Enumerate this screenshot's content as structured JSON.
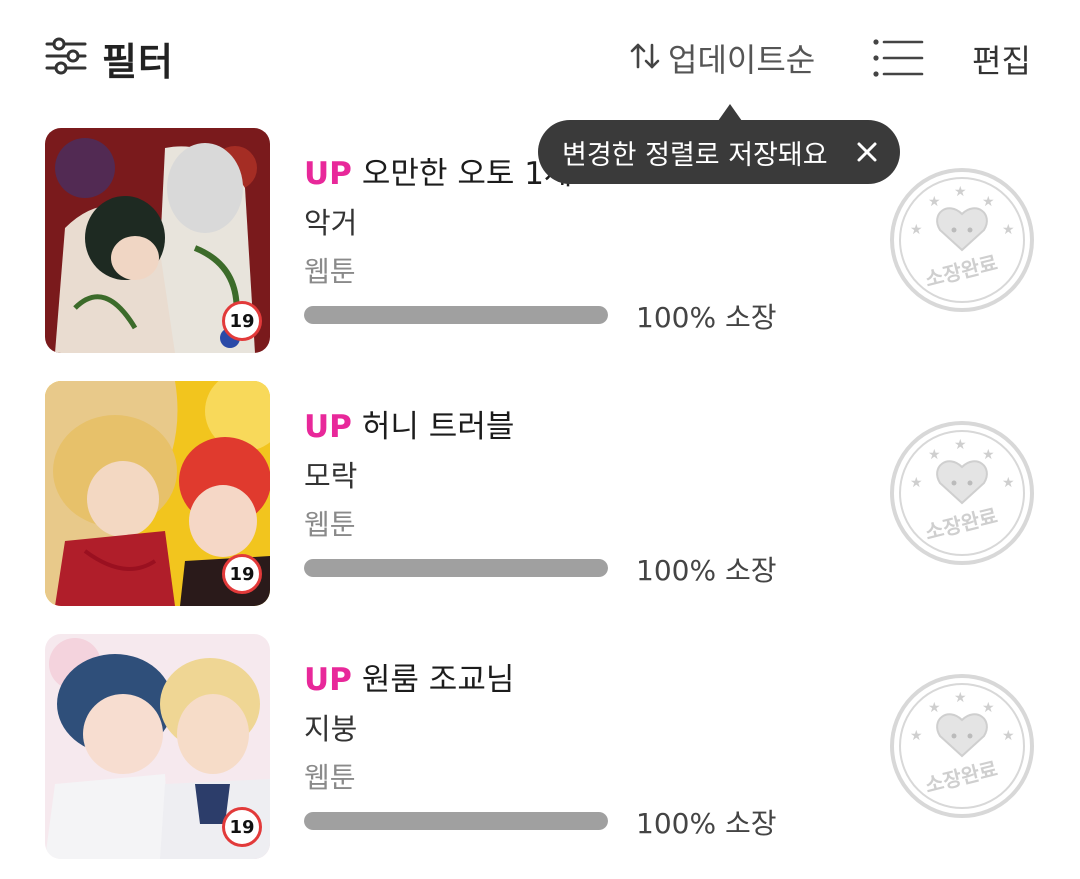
{
  "header": {
    "filter_label": "필터",
    "sort_label": "업데이트순",
    "edit_label": "편집"
  },
  "tooltip": {
    "text": "변경한 정렬로 저장돼요"
  },
  "items": [
    {
      "badge": "UP",
      "title": "오만한 오토 1세",
      "author": "악거",
      "category": "웹툰",
      "progress": 100,
      "progress_text": "100% 소장",
      "age": "19",
      "stamp_text": "소장완료"
    },
    {
      "badge": "UP",
      "title": "허니 트러블",
      "author": "모락",
      "category": "웹툰",
      "progress": 100,
      "progress_text": "100% 소장",
      "age": "19",
      "stamp_text": "소장완료"
    },
    {
      "badge": "UP",
      "title": "원룸 조교님",
      "author": "지붕",
      "category": "웹툰",
      "progress": 100,
      "progress_text": "100% 소장",
      "age": "19",
      "stamp_text": "소장완료"
    }
  ],
  "colors": {
    "up_badge": "#e8289a",
    "tooltip_bg": "#3a3a3a",
    "progress_fill": "#a0a0a0",
    "age_badge_ring": "#e23a3a"
  }
}
